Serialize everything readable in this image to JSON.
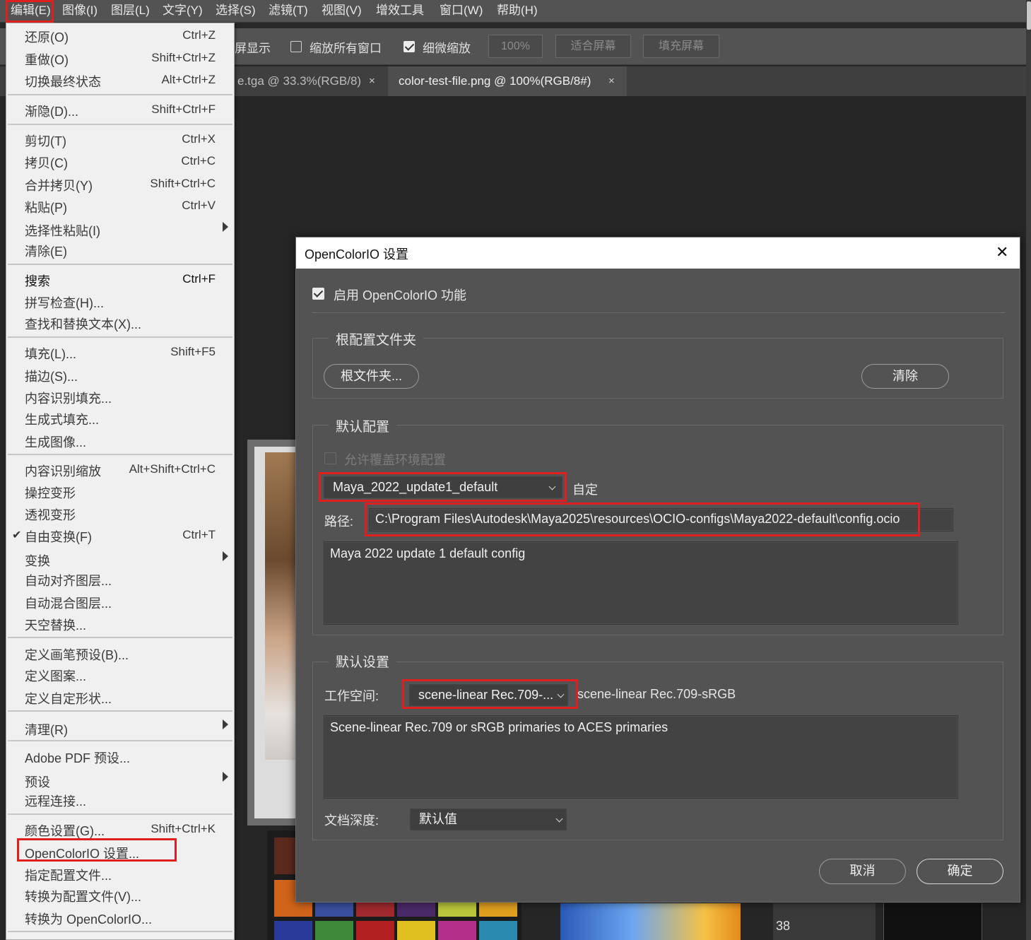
{
  "menubar": {
    "items": [
      "编辑(E)",
      "图像(I)",
      "图层(L)",
      "文字(Y)",
      "选择(S)",
      "滤镜(T)",
      "视图(V)",
      "增效工具",
      "窗口(W)",
      "帮助(H)"
    ]
  },
  "options_bar": {
    "screen_show": "屏显示",
    "zoom_all_windows": "缩放所有窗口",
    "zoom_all_checked": false,
    "scrubby_zoom": "细微缩放",
    "scrubby_checked": true,
    "zoom_value": "100%",
    "fit_screen": "适合屏幕",
    "fill_screen": "填充屏幕"
  },
  "tabs": [
    {
      "label": "e.tga @ 33.3%(RGB/8)",
      "close": "×"
    },
    {
      "label": "color-test-file.png @ 100%(RGB/8#)",
      "close": "×"
    }
  ],
  "canvas": {
    "ruler_number": "38"
  },
  "edit_menu": {
    "items": [
      {
        "label": "还原(O)",
        "shortcut": "Ctrl+Z"
      },
      {
        "label": "重做(O)",
        "shortcut": "Shift+Ctrl+Z"
      },
      {
        "label": "切换最终状态",
        "shortcut": "Alt+Ctrl+Z"
      },
      {
        "label": "渐隐(D)...",
        "shortcut": "Shift+Ctrl+F"
      },
      {
        "label": "剪切(T)",
        "shortcut": "Ctrl+X"
      },
      {
        "label": "拷贝(C)",
        "shortcut": "Ctrl+C"
      },
      {
        "label": "合并拷贝(Y)",
        "shortcut": "Shift+Ctrl+C"
      },
      {
        "label": "粘贴(P)",
        "shortcut": "Ctrl+V"
      },
      {
        "label": "选择性粘贴(I)",
        "shortcut": ""
      },
      {
        "label": "清除(E)",
        "shortcut": ""
      },
      {
        "label": "搜索",
        "shortcut": "Ctrl+F"
      },
      {
        "label": "拼写检查(H)...",
        "shortcut": ""
      },
      {
        "label": "查找和替换文本(X)...",
        "shortcut": ""
      },
      {
        "label": "填充(L)...",
        "shortcut": "Shift+F5"
      },
      {
        "label": "描边(S)...",
        "shortcut": ""
      },
      {
        "label": "内容识别填充...",
        "shortcut": ""
      },
      {
        "label": "生成式填充...",
        "shortcut": ""
      },
      {
        "label": "生成图像...",
        "shortcut": ""
      },
      {
        "label": "内容识别缩放",
        "shortcut": "Alt+Shift+Ctrl+C"
      },
      {
        "label": "操控变形",
        "shortcut": ""
      },
      {
        "label": "透视变形",
        "shortcut": ""
      },
      {
        "label": "自由变换(F)",
        "shortcut": "Ctrl+T"
      },
      {
        "label": "变换",
        "shortcut": ""
      },
      {
        "label": "自动对齐图层...",
        "shortcut": ""
      },
      {
        "label": "自动混合图层...",
        "shortcut": ""
      },
      {
        "label": "天空替换...",
        "shortcut": ""
      },
      {
        "label": "定义画笔预设(B)...",
        "shortcut": ""
      },
      {
        "label": "定义图案...",
        "shortcut": ""
      },
      {
        "label": "定义自定形状...",
        "shortcut": ""
      },
      {
        "label": "清理(R)",
        "shortcut": ""
      },
      {
        "label": "Adobe PDF 预设...",
        "shortcut": ""
      },
      {
        "label": "预设",
        "shortcut": ""
      },
      {
        "label": "远程连接...",
        "shortcut": ""
      },
      {
        "label": "颜色设置(G)...",
        "shortcut": "Shift+Ctrl+K"
      },
      {
        "label": "OpenColorIO 设置...",
        "shortcut": ""
      },
      {
        "label": "指定配置文件...",
        "shortcut": ""
      },
      {
        "label": "转换为配置文件(V)...",
        "shortcut": ""
      },
      {
        "label": "转换为 OpenColorIO...",
        "shortcut": ""
      }
    ],
    "checked_item": "✔"
  },
  "dialog": {
    "title": "OpenColorIO 设置",
    "close": "✕",
    "enable_label": "启用 OpenColorIO 功能",
    "enable_checked": true,
    "root_group": {
      "title": "根配置文件夹",
      "root_button": "根文件夹...",
      "clear_button": "清除"
    },
    "default_config_group": {
      "title": "默认配置",
      "allow_override": "允许覆盖环境配置",
      "allow_override_checked": false,
      "config_select": "Maya_2022_update1_default",
      "config_custom": "自定",
      "path_label": "路径:",
      "path_value": "C:\\Program Files\\Autodesk\\Maya2025\\resources\\OCIO-configs\\Maya2022-default\\config.ocio",
      "description": "Maya 2022 update 1 default config"
    },
    "default_settings_group": {
      "title": "默认设置",
      "working_space_label": "工作空间:",
      "working_space_select": "scene-linear Rec.709-...",
      "working_space_full": "scene-linear Rec.709-sRGB",
      "working_space_desc": "Scene-linear Rec.709 or sRGB primaries to ACES primaries",
      "doc_depth_label": "文档深度:",
      "doc_depth_select": "默认值"
    },
    "cancel_button": "取消",
    "ok_button": "确定"
  },
  "colors": {
    "highlight_red": "#e02020",
    "menu_bg": "#f0f0f0",
    "dialog_bg": "#535353"
  }
}
